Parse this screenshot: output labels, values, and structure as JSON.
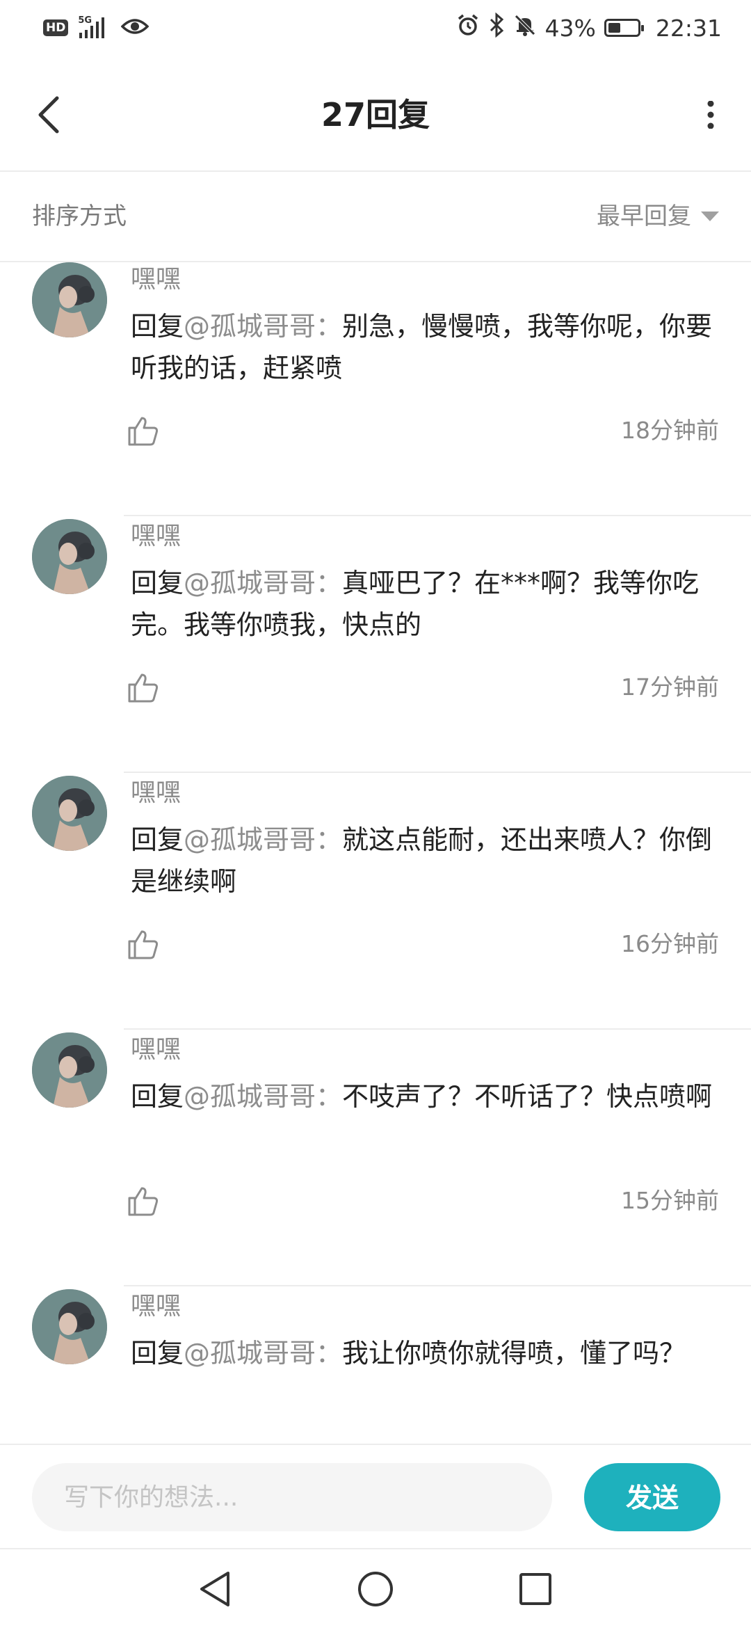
{
  "status_bar": {
    "hd": "HD",
    "network": "5G",
    "battery_percent": "43%",
    "battery_level": 0.43,
    "time": "22:31"
  },
  "header": {
    "title": "27回复",
    "back_icon": "back-arrow-icon",
    "more_icon": "more-vertical-icon"
  },
  "sort": {
    "label": "排序方式",
    "selected": "最早回复"
  },
  "comments": [
    {
      "user": "嘿嘿",
      "reply_prefix": "回复",
      "mention": "@孤城哥哥",
      "colon": "：",
      "text": "别急，慢慢喷，我等你呢，你要听我的话，赶紧喷",
      "time": "18分钟前"
    },
    {
      "user": "嘿嘿",
      "reply_prefix": "回复",
      "mention": "@孤城哥哥",
      "colon": "：",
      "text": "真哑巴了？在***啊？我等你吃完。我等你喷我，快点的",
      "time": "17分钟前"
    },
    {
      "user": "嘿嘿",
      "reply_prefix": "回复",
      "mention": "@孤城哥哥",
      "colon": "：",
      "text": "就这点能耐，还出来喷人？你倒是继续啊",
      "time": "16分钟前"
    },
    {
      "user": "嘿嘿",
      "reply_prefix": "回复",
      "mention": "@孤城哥哥",
      "colon": "：",
      "text": "不吱声了？不听话了？快点喷啊",
      "time": "15分钟前"
    },
    {
      "user": "嘿嘿",
      "reply_prefix": "回复",
      "mention": "@孤城哥哥",
      "colon": "：",
      "text": "我让你喷你就得喷，懂了吗？",
      "time": ""
    }
  ],
  "composer": {
    "placeholder": "写下你的想法...",
    "send_label": "发送"
  },
  "colors": {
    "accent": "#1eb1bd",
    "text_primary": "#222222",
    "text_secondary": "#8c8c8c",
    "divider": "#ececec"
  }
}
